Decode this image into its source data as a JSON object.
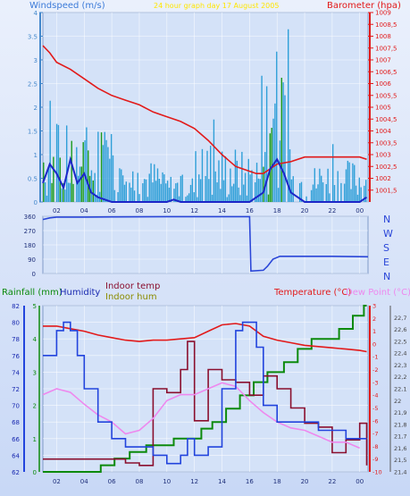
{
  "colors": {
    "wind_axis": "#4488cc",
    "wind_avg": "#2f9fd8",
    "wind_gust": "#1c26c8",
    "wind_green": "#1a9a1a",
    "barometer": "#e21a1a",
    "compass": "#2a46d8",
    "rainfall": "#0c8a0c",
    "humidity": "#2244dd",
    "indoor_temp": "#8a0f2e",
    "indoor_hum": "#8c8c00",
    "temperature": "#e21a1a",
    "dew_point": "#ee88ee",
    "title": "#ffe600",
    "grid": "#ffffff"
  },
  "header": {
    "title": "24 hour graph day 17 August 2005"
  },
  "compass_labels": [
    "N",
    "W",
    "S",
    "E",
    "N"
  ],
  "chart_data": [
    {
      "type": "line",
      "title": "24 hour graph day 17 August 2005",
      "x_ticks": [
        "02",
        "04",
        "06",
        "08",
        "10",
        "12",
        "14",
        "16",
        "18",
        "20",
        "22",
        "00"
      ],
      "xlim": [
        1,
        24.6
      ],
      "y_left": {
        "label": "Windspeed (m/s)",
        "ylim": [
          0,
          4
        ],
        "ticks": [
          "0",
          "0.5",
          "1",
          "1.5",
          "2",
          "2.5",
          "3",
          "3.5",
          "4"
        ]
      },
      "y_right": {
        "label": "Barometer (hpa)",
        "ylim": [
          1001,
          1009
        ],
        "ticks": [
          "1001,5",
          "1002",
          "1002,5",
          "1003",
          "1003,5",
          "1004",
          "1004,5",
          "1005",
          "1005,5",
          "1006",
          "1006,5",
          "1007",
          "1007,5",
          "1008",
          "1008,5",
          "1009"
        ]
      },
      "series": [
        {
          "name": "Barometer",
          "axis": "right",
          "x": [
            1,
            1.5,
            2,
            3,
            4,
            5,
            6,
            7,
            8,
            9,
            10,
            11,
            12,
            13,
            14,
            15,
            16,
            16.5,
            17,
            18,
            19,
            20,
            21,
            22,
            23,
            24,
            24.5
          ],
          "y": [
            1007.6,
            1007.3,
            1006.9,
            1006.6,
            1006.2,
            1005.8,
            1005.5,
            1005.3,
            1005.1,
            1004.8,
            1004.6,
            1004.4,
            1004.1,
            1003.6,
            1003.0,
            1002.5,
            1002.3,
            1002.2,
            1002.2,
            1002.6,
            1002.7,
            1002.9,
            1002.9,
            1002.9,
            1002.9,
            1002.9,
            1002.8
          ]
        },
        {
          "name": "Wind gust",
          "axis": "left",
          "x": [
            1,
            1.5,
            2,
            2.5,
            3,
            3.5,
            4,
            4.5,
            5,
            6,
            7,
            8,
            9,
            10,
            10.5,
            11,
            12,
            13,
            14,
            15,
            16,
            17,
            17.5,
            18,
            18.5,
            19,
            20,
            21,
            22,
            23,
            24,
            24.5
          ],
          "y": [
            0.4,
            0.8,
            0.6,
            0.3,
            0.9,
            0.4,
            0.6,
            0.2,
            0.1,
            0.0,
            0.0,
            0.0,
            0.0,
            0.0,
            0.05,
            0.0,
            0.0,
            0.0,
            0.0,
            0.0,
            0.0,
            0.2,
            0.7,
            0.9,
            0.6,
            0.2,
            0.0,
            0.0,
            0.0,
            0.0,
            0.0,
            0.1
          ]
        }
      ]
    },
    {
      "type": "line",
      "x_ticks": [],
      "xlim": [
        1,
        24.6
      ],
      "y_left": {
        "ylim": [
          0,
          360
        ],
        "ticks": [
          "0",
          "90",
          "180",
          "270",
          "360"
        ]
      },
      "series": [
        {
          "name": "Wind direction",
          "x": [
            1,
            1.5,
            2,
            4,
            6,
            10,
            16,
            16.1,
            17,
            17.3,
            17.7,
            18.2,
            20,
            22,
            24.6
          ],
          "y": [
            340,
            350,
            355,
            355,
            356,
            358,
            358,
            15,
            20,
            45,
            90,
            108,
            108,
            108,
            105
          ]
        }
      ]
    },
    {
      "type": "line",
      "x_ticks": [
        "02",
        "04",
        "06",
        "08",
        "10",
        "12",
        "14",
        "16",
        "18",
        "20",
        "22",
        "00"
      ],
      "xlim": [
        1,
        24.6
      ],
      "y_left": {
        "label": "Humidity",
        "ylim": [
          62,
          82
        ],
        "ticks": [
          "62",
          "64",
          "66",
          "68",
          "70",
          "72",
          "74",
          "76",
          "78",
          "80",
          "82"
        ]
      },
      "y_left_rain": {
        "label": "Rainfall (mm)",
        "ylim": [
          0,
          5
        ],
        "ticks": [
          "0",
          "1",
          "2",
          "3",
          "4",
          "5"
        ]
      },
      "y_right": {
        "label": "Temperature (°C)",
        "ylim": [
          -10,
          3
        ],
        "ticks": [
          "3",
          "2",
          "1",
          "0",
          "-1",
          "-2",
          "-3",
          "-4",
          "-5",
          "-6",
          "-7",
          "-8",
          "-9",
          "-10"
        ]
      },
      "y_right_dew": {
        "label": "Dew Point (°C)",
        "ylim": [
          21.4,
          22.8
        ],
        "ticks": [
          "22,7",
          "22,6",
          "22,5",
          "22,4",
          "22,3",
          "22,2",
          "22,1",
          "22",
          "21,9",
          "21,8",
          "21,7",
          "21,6",
          "21,5",
          "21,4"
        ]
      },
      "labels_extra": [
        "Indoor temp",
        "Indoor hum"
      ],
      "series": [
        {
          "name": "Temperature",
          "axis": "right",
          "x": [
            1,
            2,
            3,
            4,
            5,
            6,
            7,
            8,
            9,
            10,
            11,
            12,
            13,
            14,
            15,
            16,
            17,
            18,
            19,
            20,
            21,
            22,
            23,
            24,
            24.5
          ],
          "y": [
            1.4,
            1.4,
            1.2,
            1.0,
            0.7,
            0.5,
            0.3,
            0.2,
            0.3,
            0.3,
            0.4,
            0.5,
            1.0,
            1.5,
            1.6,
            1.4,
            0.6,
            0.3,
            0.1,
            -0.1,
            -0.2,
            -0.3,
            -0.4,
            -0.5,
            -0.6
          ]
        },
        {
          "name": "Humidity",
          "axis": "left",
          "x": [
            1,
            2,
            2.5,
            3,
            3.5,
            4,
            5,
            6,
            7,
            8,
            9,
            10,
            10.5,
            11,
            11.5,
            12,
            13,
            14,
            15,
            15.5,
            16,
            16.5,
            17,
            18,
            19,
            20,
            21,
            22,
            23,
            24,
            24.5
          ],
          "y": [
            76,
            79,
            80,
            79,
            76,
            72,
            68,
            66,
            65,
            65,
            64,
            63,
            63,
            64,
            66,
            64,
            65,
            72,
            79,
            80,
            80,
            77,
            70,
            68,
            68,
            68,
            67,
            67,
            66,
            66,
            66
          ]
        },
        {
          "name": "Dew Point",
          "axis": "right_dew",
          "x": [
            1,
            2,
            3,
            4,
            5,
            6,
            7,
            8,
            9,
            10,
            11,
            12,
            13,
            14,
            15,
            16,
            17,
            18,
            19,
            20,
            21,
            22,
            23,
            24
          ],
          "y": [
            22.05,
            22.1,
            22.07,
            21.97,
            21.88,
            21.82,
            21.72,
            21.75,
            21.85,
            22.0,
            22.05,
            22.05,
            22.1,
            22.15,
            22.12,
            22.0,
            21.9,
            21.82,
            21.77,
            21.75,
            21.7,
            21.65,
            21.65,
            21.6
          ]
        },
        {
          "name": "Rainfall",
          "axis": "left_rain",
          "x": [
            1,
            5,
            5.2,
            6,
            6.2,
            7,
            7.3,
            8,
            8.5,
            10,
            10.5,
            12,
            12.5,
            13,
            13.3,
            14,
            14.3,
            15,
            15.3,
            16,
            16.3,
            17,
            17.3,
            18,
            18.5,
            19,
            19.5,
            20,
            20.5,
            22,
            22.5,
            23,
            23.5,
            24,
            24.3,
            24.5
          ],
          "y": [
            0,
            0,
            0.2,
            0.2,
            0.4,
            0.4,
            0.6,
            0.6,
            0.8,
            0.8,
            1.0,
            1.0,
            1.3,
            1.3,
            1.5,
            1.5,
            1.9,
            1.9,
            2.3,
            2.3,
            2.7,
            2.7,
            3.0,
            3.0,
            3.3,
            3.3,
            3.7,
            3.7,
            4.0,
            4.0,
            4.3,
            4.3,
            4.7,
            4.7,
            5.0,
            5.0
          ]
        },
        {
          "name": "Indoor temp",
          "axis": "right",
          "x": [
            1,
            3,
            5,
            6,
            7,
            8,
            9,
            10,
            11,
            11.5,
            12,
            13,
            14,
            15,
            16,
            17,
            18,
            19,
            20,
            21,
            22,
            23,
            24,
            24.5
          ],
          "y": [
            -9.0,
            -9.0,
            -9.0,
            -9.0,
            -9.3,
            -9.5,
            -3.5,
            -3.8,
            -2.0,
            0.2,
            -6.0,
            -2.0,
            -2.8,
            -3.0,
            -4.0,
            -2.5,
            -3.5,
            -5.0,
            -6.2,
            -6.5,
            -8.5,
            -7.5,
            -6.2,
            -9.5
          ]
        }
      ]
    }
  ]
}
